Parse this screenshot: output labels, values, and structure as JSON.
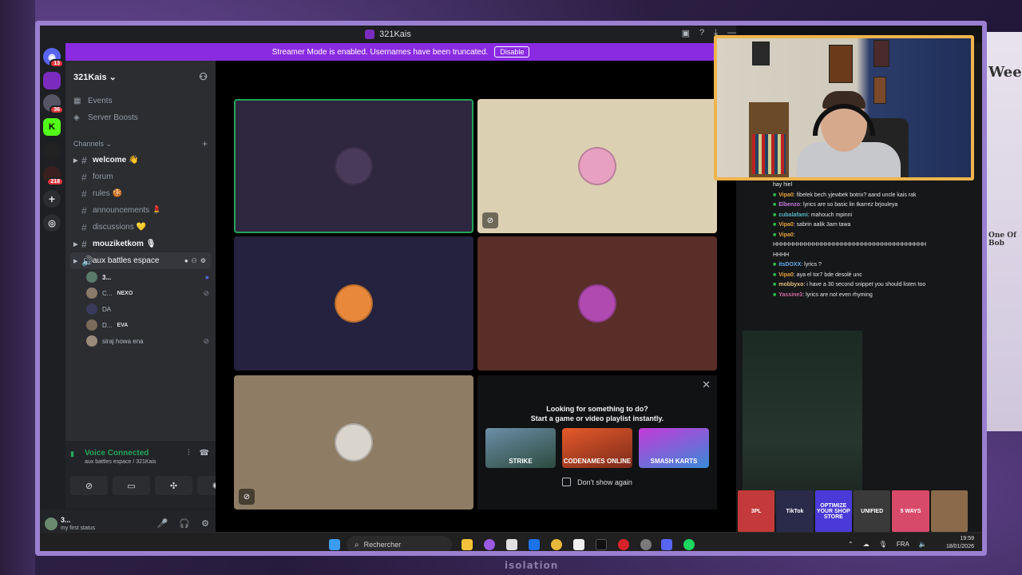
{
  "window": {
    "title": "321Kais",
    "banner_text": "Streamer Mode is enabled. Usernames have been truncated.",
    "banner_button": "Disable"
  },
  "guild_badges": {
    "dm": "13",
    "second": "36",
    "third": "218"
  },
  "sidebar": {
    "server_name": "321Kais ⌄",
    "links": [
      {
        "label": "Events",
        "icon": "calendar-icon"
      },
      {
        "label": "Server Boosts",
        "icon": "boost-icon"
      }
    ],
    "category_label": "Channels ⌄",
    "channels": [
      {
        "label": "welcome 👋",
        "expandable": true,
        "bold": true
      },
      {
        "label": "forum",
        "expandable": false,
        "bold": false
      },
      {
        "label": "rules 🍪",
        "expandable": false,
        "bold": false
      },
      {
        "label": "announcements 💄",
        "expandable": false,
        "bold": false
      },
      {
        "label": "discussions 💛",
        "expandable": false,
        "bold": false
      },
      {
        "label": "mouziketkom 🎙",
        "expandable": true,
        "bold": true
      }
    ],
    "voice_channel": "aux battles espace",
    "voice_users": [
      {
        "name": "3...",
        "tag": ""
      },
      {
        "name": "C...",
        "tag": "NEXO"
      },
      {
        "name": "DA",
        "tag": ""
      },
      {
        "name": "D...",
        "tag": "EVA"
      },
      {
        "name": "siraj howa ena",
        "tag": ""
      }
    ]
  },
  "voice_panel": {
    "status": "Voice Connected",
    "location": "aux battles espace / 321Kais"
  },
  "user_panel": {
    "name": "3...",
    "status": "my first status"
  },
  "activity": {
    "line1": "Looking for something to do?",
    "line2": "Start a game or video playlist instantly.",
    "games": [
      "STRIKE",
      "CODENAMES ONLINE",
      "SMASH KARTS"
    ],
    "dont_show": "Don't show again"
  },
  "chat": [
    {
      "user": "",
      "msg": "hay hiel",
      "color": "#e6e6e6"
    },
    {
      "user": "Vipa0",
      "msg": ": fibelek bech yjewbek botrix? aand uncle kais rak",
      "color": "#e6a23c"
    },
    {
      "user": "Elbenzo",
      "msg": ": lyrics are so basic lin tkarrez brjouleya",
      "color": "#c678dd"
    },
    {
      "user": "cubalafami",
      "msg": ": mahouch mpinni",
      "color": "#56b6c2"
    },
    {
      "user": "Vipa0",
      "msg": ": sabrin aalik 3am tawa",
      "color": "#e6a23c"
    },
    {
      "user": "Vipa0",
      "msg": ":",
      "color": "#e6a23c"
    },
    {
      "user": "",
      "msg": "HHHHHHHHHHHHHHHHHHHHHHHHHHHHHHHHHHHHHH",
      "color": "#e6e6e6"
    },
    {
      "user": "",
      "msg": "HHHH",
      "color": "#e6e6e6"
    },
    {
      "user": "itsDOXX",
      "msg": ": lyrics ?",
      "color": "#61afef"
    },
    {
      "user": "Vipa0",
      "msg": ": aya el tor7 bde desolé unc",
      "color": "#e6a23c"
    },
    {
      "user": "mobbyxo",
      "msg": ": i have a 30 second snippet you should listen too",
      "color": "#e5c07b"
    },
    {
      "user": "Yassine3",
      "msg": ": lyrics are not even rhyming",
      "color": "#d16d9e"
    }
  ],
  "thumbs": [
    "3PL",
    "TikTok",
    "OPTIMIZE YOUR SHOP STORE",
    "UNIFIED",
    "5 WAYS",
    ""
  ],
  "taskbar": {
    "search_placeholder": "Rechercher",
    "lang": "FRA",
    "time": "19:59",
    "date": "18/01/2026"
  },
  "background": {
    "bottom_text": "isolation",
    "right_words": [
      "Week",
      "One Of Bob"
    ]
  }
}
